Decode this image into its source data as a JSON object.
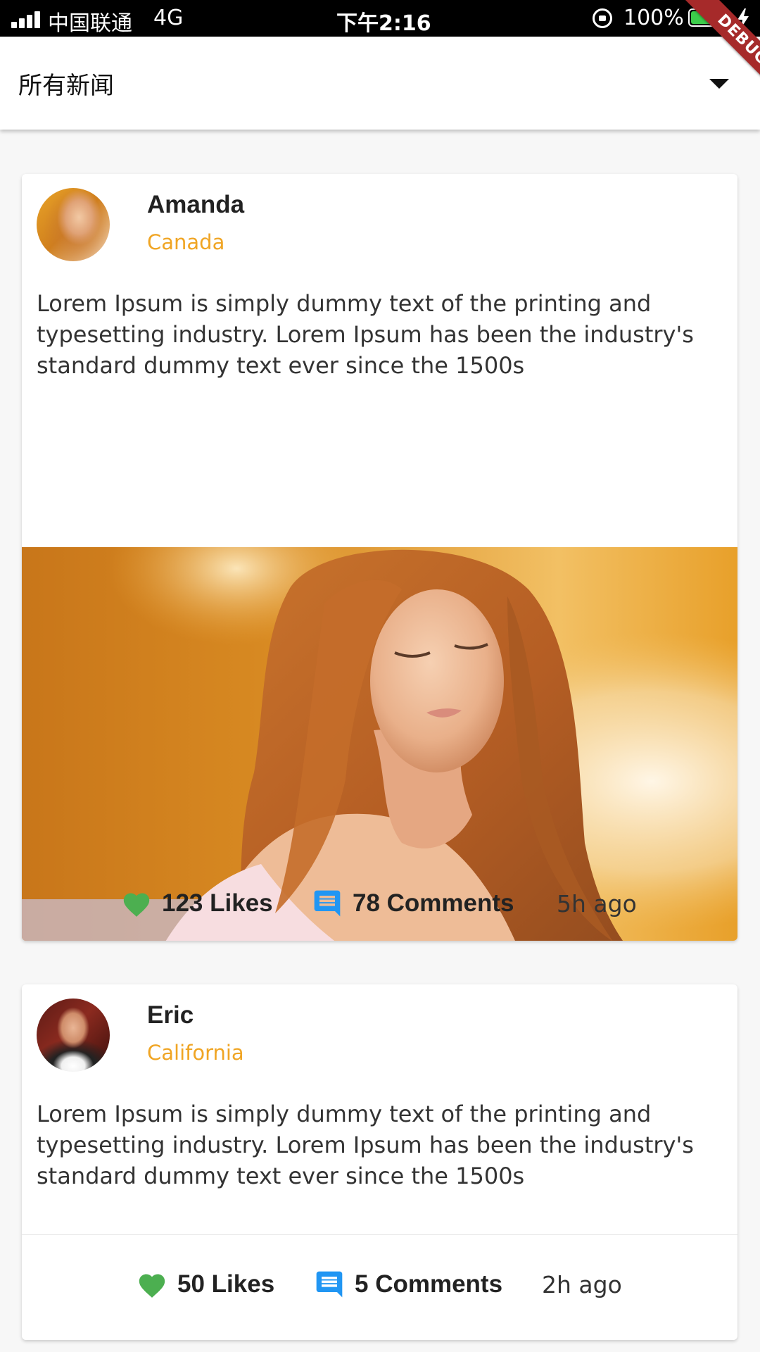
{
  "status_bar": {
    "carrier": "中国联通",
    "network": "4G",
    "time": "下午2:16",
    "battery_percent": "100%",
    "battery_level": 1.0,
    "icons": [
      "signal-icon",
      "rotation-lock-icon",
      "battery-icon",
      "charging-bolt-icon"
    ]
  },
  "app_bar": {
    "title": "所有新闻",
    "dropdown_icon": "dropdown-arrow-icon",
    "debug_banner": "DEBUG"
  },
  "colors": {
    "location": "#f0a524",
    "heart": "#4caf50",
    "comment": "#2196f3",
    "debug_banner": "#a62a2a",
    "battery": "#3ccd4b"
  },
  "posts": [
    {
      "author": "Amanda",
      "location": "Canada",
      "text": "Lorem Ipsum is simply dummy text of the printing and typesetting industry. Lorem Ipsum has been the industry's standard dummy text ever since the 1500s",
      "has_image": true,
      "likes": "123 Likes",
      "comments": "78 Comments",
      "time": "5h ago"
    },
    {
      "author": "Eric",
      "location": "California",
      "text": "Lorem Ipsum is simply dummy text of the printing and typesetting industry. Lorem Ipsum has been the industry's standard dummy text ever since the 1500s",
      "has_image": false,
      "likes": "50 Likes",
      "comments": "5 Comments",
      "time": "2h ago"
    }
  ]
}
